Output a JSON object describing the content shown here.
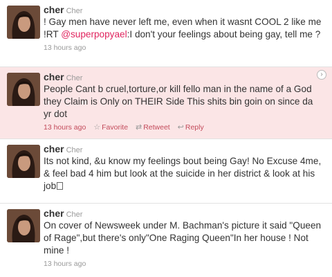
{
  "tweets": [
    {
      "screen_name": "cher",
      "full_name": "Cher",
      "text_before": "! Gay men have never left me, even when it wasnt COOL 2 like me !RT ",
      "mention": "@superpopyael",
      "text_after": ":I don't your feelings about being gay, tell me ?",
      "timestamp": "13 hours ago"
    },
    {
      "screen_name": "cher",
      "full_name": "Cher",
      "text": "People Cant b cruel,torture,or kill fello man in the name of a God they Claim is Only on THEIR Side This shits bin goin on since da yr dot",
      "timestamp": "13 hours ago",
      "favorite_label": "Favorite",
      "retweet_label": "Retweet",
      "reply_label": "Reply"
    },
    {
      "screen_name": "cher",
      "full_name": "Cher",
      "text": "Its not kind, &u know my feelings bout being Gay! No Excuse 4me, & feel bad 4 him but look at the suicide in her district & look at his job",
      "timestamp": ""
    },
    {
      "screen_name": "cher",
      "full_name": "Cher",
      "text": "On cover of Newsweek under M. Bachman's picture it said \"Queen of Rage\",but there's only\"One Raging Queen\"In her house ! Not mine !",
      "timestamp": "13 hours ago"
    }
  ],
  "icons": {
    "favorite": "star-icon",
    "retweet": "retweet-icon",
    "reply": "reply-icon",
    "expand": "chevron-right-icon"
  },
  "colors": {
    "hover_background": "#fbe5e6",
    "mention": "#e0245e",
    "action": "#c34b5b"
  }
}
